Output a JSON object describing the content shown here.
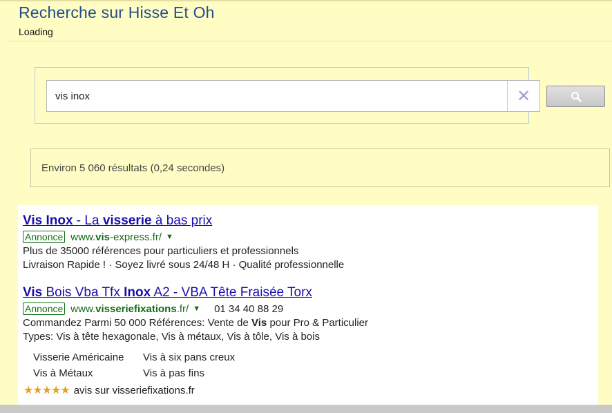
{
  "header": {
    "title": "Recherche sur Hisse Et Oh",
    "status": "Loading"
  },
  "search": {
    "value": "vis inox",
    "clear_icon": "close-icon",
    "submit_icon": "search-icon"
  },
  "results_info": "Environ 5 060 résultats (0,24 secondes)",
  "ads": [
    {
      "title_parts": [
        {
          "text": "Vis Inox",
          "bold": true
        },
        {
          "text": " - La ",
          "bold": false
        },
        {
          "text": "visserie",
          "bold": true
        },
        {
          "text": " à bas prix",
          "bold": false
        }
      ],
      "badge": "Annonce",
      "url_parts": [
        {
          "text": "www.",
          "bold": false
        },
        {
          "text": "vis",
          "bold": true
        },
        {
          "text": "-express.fr/",
          "bold": false
        }
      ],
      "desc_lines": [
        "Plus de 35000 références pour particuliers et professionnels",
        "Livraison Rapide ! · Soyez livré sous 24/48 H · Qualité professionnelle"
      ]
    },
    {
      "title_parts": [
        {
          "text": "Vis",
          "bold": true
        },
        {
          "text": " Bois Vba Tfx ",
          "bold": false
        },
        {
          "text": "Inox",
          "bold": true
        },
        {
          "text": " A2 - VBA Tête Fraisée Torx",
          "bold": false
        }
      ],
      "badge": "Annonce",
      "url_parts": [
        {
          "text": "www.",
          "bold": false
        },
        {
          "text": "visseriefixations",
          "bold": true
        },
        {
          "text": ".fr/",
          "bold": false
        }
      ],
      "phone": "01 34 40 88 29",
      "desc_line1_parts": [
        {
          "text": "Commandez Parmi 50 000 Références: Vente de ",
          "bold": false
        },
        {
          "text": "Vis",
          "bold": true
        },
        {
          "text": " pour Pro & Particulier",
          "bold": false
        }
      ],
      "desc_line2": "Types: Vis à tête hexagonale, Vis à métaux, Vis à tôle, Vis à bois",
      "sitelinks": [
        "Visserie Américaine",
        "Vis à six pans creux",
        "Vis à Métaux",
        "Vis à pas fins"
      ],
      "rating_stars": "★★★★★",
      "rating_text": "avis sur visseriefixations.fr"
    }
  ],
  "colors": {
    "background": "#fffdc4",
    "title": "#1f4e8c",
    "ad_link": "#1a0dab",
    "ad_url": "#126e12",
    "stars": "#e7a11f"
  }
}
